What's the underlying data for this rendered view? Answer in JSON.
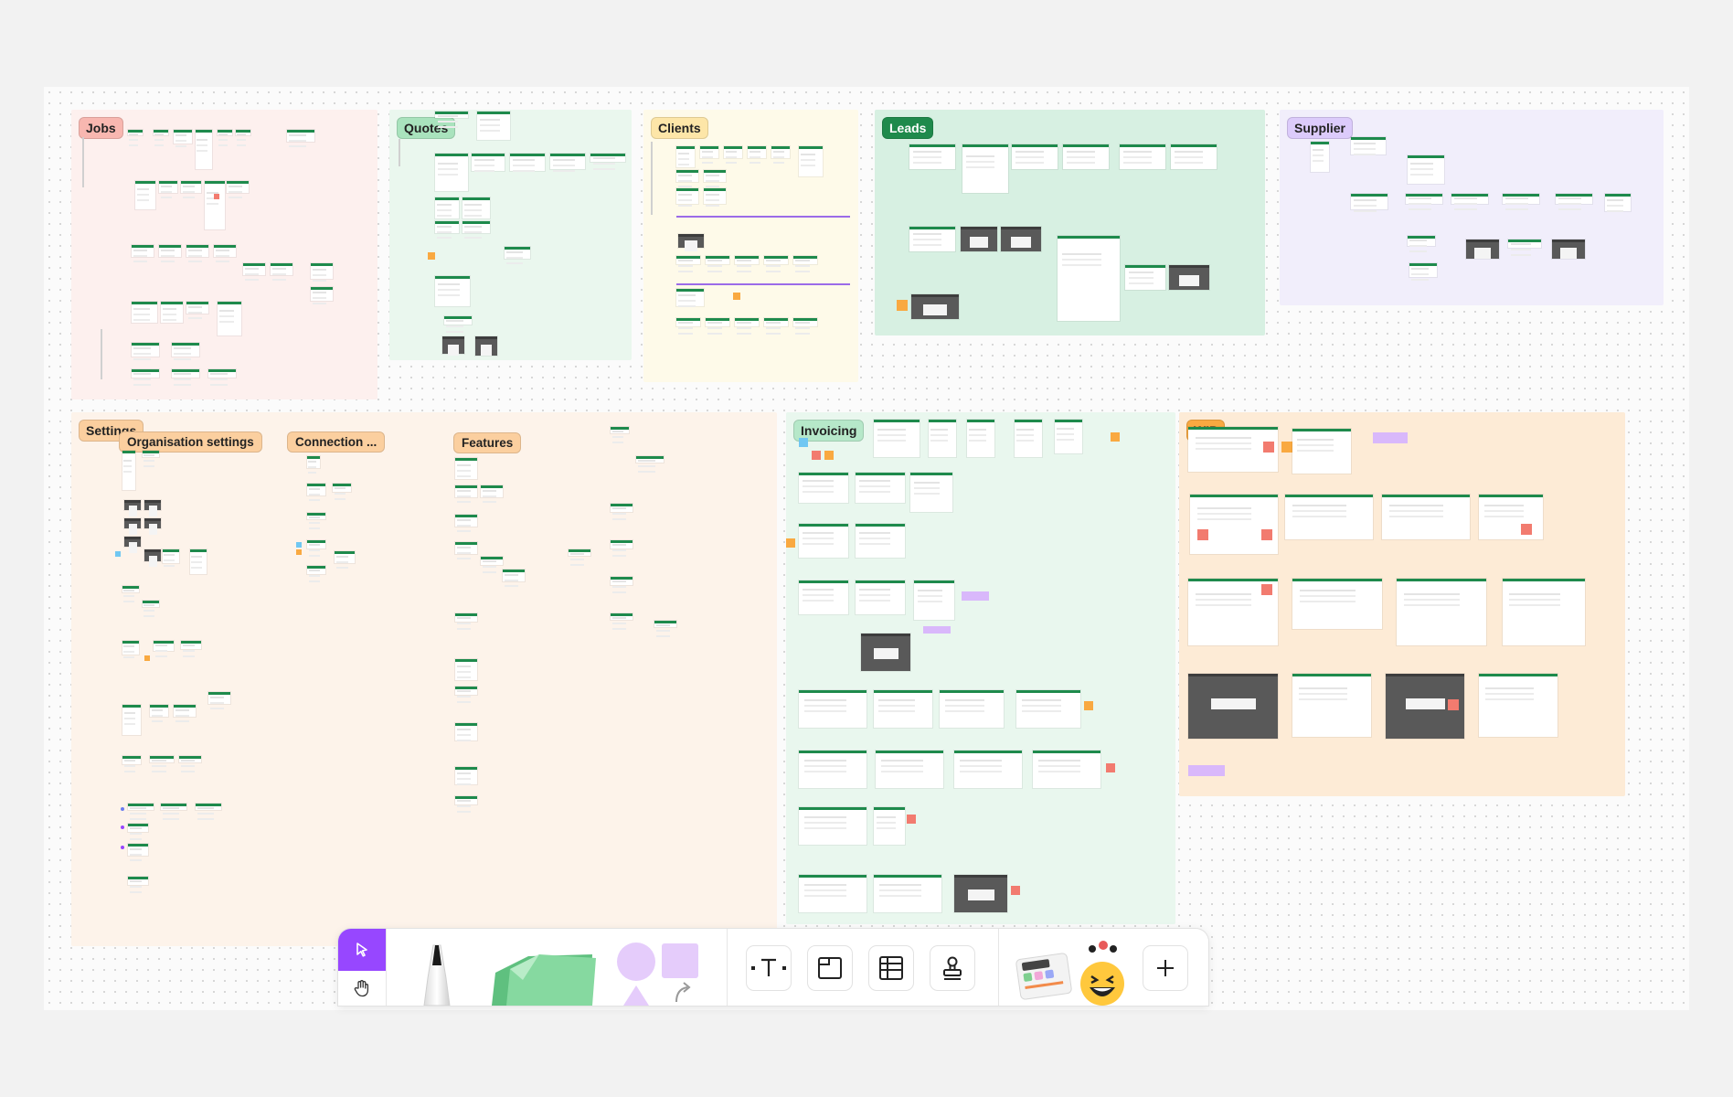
{
  "board": {
    "sections": {
      "jobs": "Jobs",
      "quotes": "Quotes",
      "clients": "Clients",
      "leads": "Leads",
      "supplier": "Supplier",
      "settings": "Settings",
      "organisation_settings": "Organisation settings",
      "connection": "Connection ...",
      "features": "Features",
      "invoicing": "Invoicing",
      "wip": "WIP"
    },
    "section_colors": {
      "jobs_bg": "#fdf0ee",
      "jobs_tag": "#f8b7b0",
      "quotes_bg": "#eaf7ee",
      "quotes_tag": "#a9e3bd",
      "clients_bg": "#fefae9",
      "clients_tag": "#fde6a8",
      "leads_bg": "#d7f0e2",
      "leads_tag": "#1f8a4c",
      "supplier_bg": "#f1eefb",
      "supplier_tag": "#dccbfb",
      "settings_bg": "#fdf3ea",
      "settings_tag": "#fbcf9f",
      "invoicing_bg": "#e9f7ee",
      "invoicing_tag": "#b6e8c9",
      "wip_bg": "#fdebd6",
      "wip_tag": "#f9a941"
    }
  },
  "toolbar": {
    "accent": "#9747ff",
    "tools": [
      {
        "name": "select-tool",
        "icon": "cursor-icon"
      },
      {
        "name": "hand-tool",
        "icon": "hand-icon"
      },
      {
        "name": "marker-tool",
        "icon": "marker-icon"
      },
      {
        "name": "sticky-note-tool",
        "icon": "sticky-note-icon"
      },
      {
        "name": "shape-tool",
        "icon": "shapes-icon"
      },
      {
        "name": "text-tool",
        "icon": "text-icon"
      },
      {
        "name": "section-tool",
        "icon": "section-icon"
      },
      {
        "name": "table-tool",
        "icon": "table-icon"
      },
      {
        "name": "stamp-tool",
        "icon": "stamp-icon"
      },
      {
        "name": "widgets-tool",
        "icon": "widgets-icon"
      },
      {
        "name": "more-tool",
        "icon": "plus-icon"
      }
    ]
  }
}
